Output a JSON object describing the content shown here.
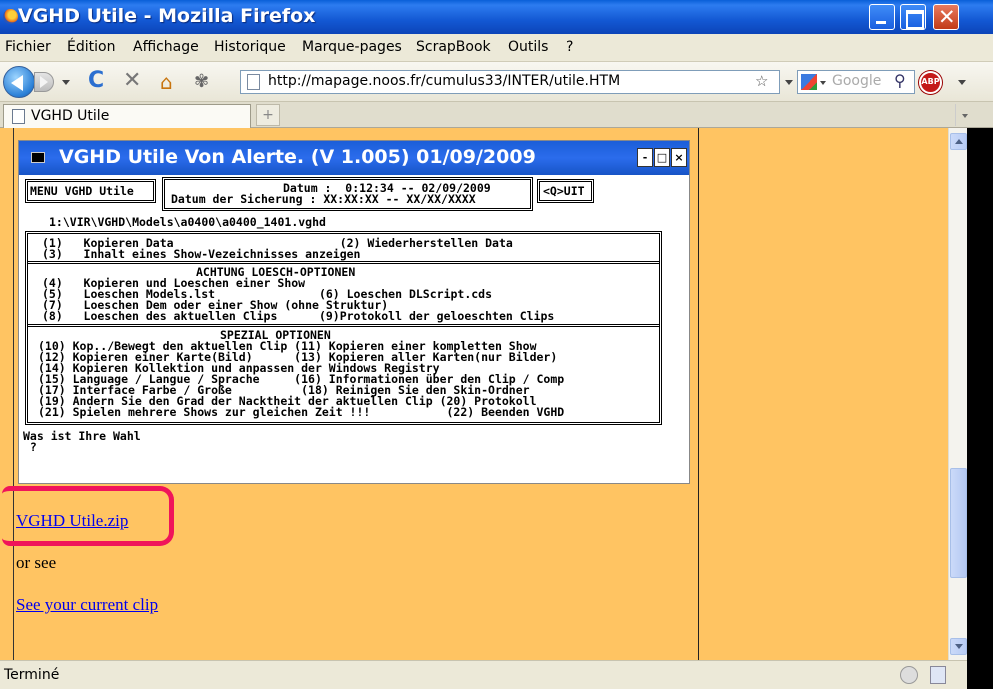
{
  "window": {
    "title": "VGHD Utile - Mozilla Firefox",
    "close_glyph": "✕"
  },
  "menu": [
    "Fichier",
    "Édition",
    "Affichage",
    "Historique",
    "Marque-pages",
    "ScrapBook",
    "Outils",
    "?"
  ],
  "toolbar": {
    "url": "http://mapage.noos.fr/cumulus33/INTER/utile.HTM",
    "search_placeholder": "Google",
    "abp_label": "ABP",
    "reload_glyph": "C",
    "stop_glyph": "✕",
    "home_glyph": "⌂",
    "star_glyph": "☆",
    "search_glyph": "⚲"
  },
  "tab": {
    "label": "VGHD Utile",
    "new_tab_glyph": "+"
  },
  "console": {
    "title": "VGHD Utile Von Alerte. (V 1.005) 01/09/2009",
    "btn_min": "-",
    "btn_max": "□",
    "btn_close": "×",
    "menu_label": "MENU VGHD Utile",
    "datum_line1": "Datum :  0:12:34 -- 02/09/2009",
    "datum_line2": "Datum der Sicherung : XX:XX:XX -- XX/XX/XXXX",
    "quit_label": "<Q>UIT",
    "path": "1:\\VIR\\VGHD\\Models\\a0400\\a0400_1401.vghd",
    "section1": "(1)   Kopieren Data                        (2) Wiederherstellen Data\n(3)   Inhalt eines Show-Vezeichnisses anzeigen",
    "section2_title": "ACHTUNG LOESCH-OPTIONEN",
    "section2": "(4)   Kopieren und Loeschen einer Show\n(5)   Loeschen Models.lst               (6) Loeschen DLScript.cds\n(7)   Loeschen Dem oder einer Show (ohne Struktur)\n(8)   Loeschen des aktuellen Clips      (9)Protokoll der geloeschten Clips",
    "section3_title": "SPEZIAL OPTIONEN",
    "section3": "(10) Kop../Bewegt den aktuellen Clip (11) Kopieren einer kompletten Show\n(12) Kopieren einer Karte(Bild)      (13) Kopieren aller Karten(nur Bilder)\n(14) Kopieren Kollektion und anpassen der Windows Registry\n(15) Language / Langue / Sprache     (16) Informationen über den Clip / Comp\n(17) Interface Farbe / Große          (18) Reinigen Sie den Skin-Ordner\n(19) Andern Sie den Grad der Nacktheit der aktuellen Clip (20) Protokoll\n(21) Spielen mehrere Shows zur gleichen Zeit !!!           (22) Beenden VGHD",
    "prompt": "Was ist Ihre Wahl\n ?"
  },
  "page": {
    "zip_link": "VGHD Utile.zip",
    "or_see": "or see",
    "clip_link": "See your current clip",
    "highlight_color": "#f0145a",
    "background_color": "#ffc462"
  },
  "status": {
    "text": "Terminé"
  }
}
